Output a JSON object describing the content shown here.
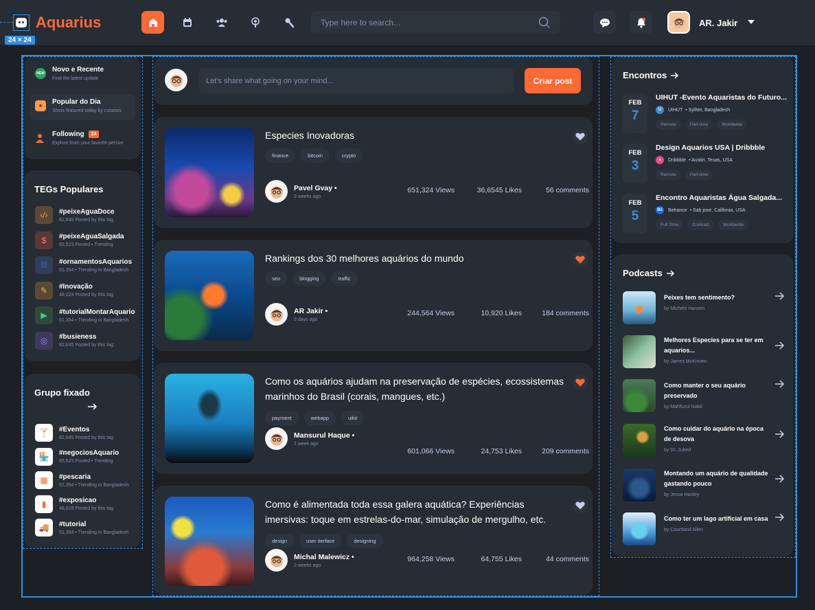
{
  "app": {
    "brand": "Aquarius",
    "selection_badge": "24 × 24",
    "search_placeholder": "Type here to search...",
    "user_name": "AR. Jakir"
  },
  "colors": {
    "accent": "#ff6934",
    "panel": "#262d34",
    "background": "#1c1f24",
    "selection": "#2f8fe5",
    "date_blue": "#3f8ad8"
  },
  "nav_icons": [
    "home-icon",
    "calendar-icon",
    "groups-icon",
    "podcast-icon",
    "microphone-icon"
  ],
  "sidebar": {
    "menu": [
      {
        "title": "Novo e Recente",
        "sub": "Find the latest update",
        "icon": "new-badge-icon"
      },
      {
        "title": "Popular do Dia",
        "sub": "Shots featured today by curators",
        "icon": "popular-icon"
      },
      {
        "title": "Following",
        "sub": "Explore from your favorite person",
        "badge": "24",
        "icon": "following-icon"
      }
    ],
    "tags_title": "TEGs Populares",
    "tags": [
      {
        "name": "#peixeAguaDoce",
        "sub": "82,645 Posted by this tag",
        "icon": "code-icon",
        "color": "#5a4a35",
        "glyph": "‹/›",
        "glyph_color": "#ff9b45"
      },
      {
        "name": "#peixeAguaSalgada",
        "sub": "65,523 Posted • Trending",
        "icon": "dollar-icon",
        "color": "#5a3a35",
        "glyph": "$",
        "glyph_color": "#ff7a5a"
      },
      {
        "name": "#ornamentosAquarios",
        "sub": "51,354 • Trending in Bangladesh",
        "icon": "ornament-icon",
        "color": "#2f3f5a",
        "glyph": "⛆",
        "glyph_color": "#4f8aff"
      },
      {
        "name": "#Inovação",
        "sub": "48,029 Posted by this tag",
        "icon": "pen-icon",
        "color": "#5a4a35",
        "glyph": "✎",
        "glyph_color": "#ffb045"
      },
      {
        "name": "#tutorialMontarAquario",
        "sub": "51,354 • Trending in Bangladesh",
        "icon": "play-icon",
        "color": "#2f4a3a",
        "glyph": "▶",
        "glyph_color": "#3fcf7a"
      },
      {
        "name": "#busieness",
        "sub": "82,645 Posted by this tag",
        "icon": "target-icon",
        "color": "#3f3a5a",
        "glyph": "◎",
        "glyph_color": "#9a8aff"
      }
    ],
    "group_title": "Grupo fixado",
    "groups": [
      {
        "name": "#Eventos",
        "sub": "82,645 Posted by this tag",
        "icon": "cocktail-icon",
        "glyph": "🍸"
      },
      {
        "name": "#negociosAquario",
        "sub": "65,523 Posted • Trending",
        "icon": "shop-icon",
        "glyph": "🏪"
      },
      {
        "name": "#pescaria",
        "sub": "51,354 • Trending in Bangladesh",
        "icon": "app-icon",
        "glyph": "▦"
      },
      {
        "name": "#exposicao",
        "sub": "48,029 Posted by this tag",
        "icon": "chart-icon",
        "glyph": "▮"
      },
      {
        "name": "#tutorial",
        "sub": "51,354 • Trending in Bangladesh",
        "icon": "truck-icon",
        "glyph": "🚚"
      }
    ]
  },
  "composer": {
    "placeholder": "Let's share what going on your mind...",
    "button": "Criar post"
  },
  "posts": [
    {
      "title": "Especies Inovadoras",
      "tags": [
        "finance",
        "bitcoin",
        "crypto"
      ],
      "liked": false,
      "author": "Pavel Gvay •",
      "time": "3 weeks ago",
      "views": "651,324 Views",
      "likes": "36,6545 Likes",
      "comments": "56 comments"
    },
    {
      "title": "Rankings dos 30 melhores aquários do mundo",
      "tags": [
        "seo",
        "blogging",
        "traffic"
      ],
      "liked": true,
      "author": "AR Jakir •",
      "time": "3 days ago",
      "views": "244,564 Views",
      "likes": "10,920 Likes",
      "comments": "184 comments"
    },
    {
      "title": "Como os aquários ajudam na preservação de espécies, ecossistemas marinhos do Brasil (corais, mangues, etc.)",
      "tags": [
        "payment",
        "webapp",
        "uikit"
      ],
      "liked": true,
      "author": "Mansurul Haque •",
      "time": "1 week ago",
      "views": "601,066 Views",
      "likes": "24,753 Likes",
      "comments": "209 comments"
    },
    {
      "title": "Como é alimentada toda essa galera aquática? Experiências imersivas: toque em estrelas-do-mar, simulação de mergulho, etc.",
      "tags": [
        "design",
        "user iterface",
        "designing"
      ],
      "liked": false,
      "author": "Michal Malewicz •",
      "time": "2 weeks ago",
      "views": "964,258 Views",
      "likes": "64,755 Likes",
      "comments": "44 comments"
    }
  ],
  "events": {
    "title": "Encontros",
    "items": [
      {
        "month": "FEB",
        "day": "7",
        "title": "UIHUT -Evento Aquaristas do Futuro...",
        "org": "UIHUT",
        "place": "• Sylhet, Bangladesh",
        "chips": [
          "Remote",
          "Part-time",
          "Worldwide"
        ],
        "logo_color": "#3f8ad8",
        "logo_text": "U"
      },
      {
        "month": "FEB",
        "day": "3",
        "title": "Design Aquarios USA | Dribbble",
        "org": "Dribbble",
        "place": "• Austin, Texas, USA",
        "chips": [
          "Remote",
          "Part-time"
        ],
        "logo_color": "#ea4c89",
        "logo_text": "●"
      },
      {
        "month": "FEB",
        "day": "5",
        "title": "Encontro Aquaristas Água Salgada...",
        "org": "Behance",
        "place": "• Sab jose, Califonia, USA",
        "chips": [
          "Full Time",
          "Contract",
          "Worldwide"
        ],
        "logo_color": "#1769ff",
        "logo_text": "Bē"
      }
    ]
  },
  "podcasts": {
    "title": "Podcasts",
    "items": [
      {
        "title": "Peixes tem sentimento?",
        "by": "by Michele Hansen"
      },
      {
        "title": "Melhores Especies para se ter em aquarios...",
        "by": "by James McKinven"
      },
      {
        "title": "Como manter o seu aquário preservado",
        "by": "by Mahfuzul Nabil"
      },
      {
        "title": "Como cuidar do aquário na época de desova",
        "by": "by Dr. Jubed"
      },
      {
        "title": "Montando um aquário de qualidade gastando pouco",
        "by": "by Jesse Hanley"
      },
      {
        "title": "Como ter um lago artificial em casa",
        "by": "by Courtland Allen"
      }
    ]
  }
}
